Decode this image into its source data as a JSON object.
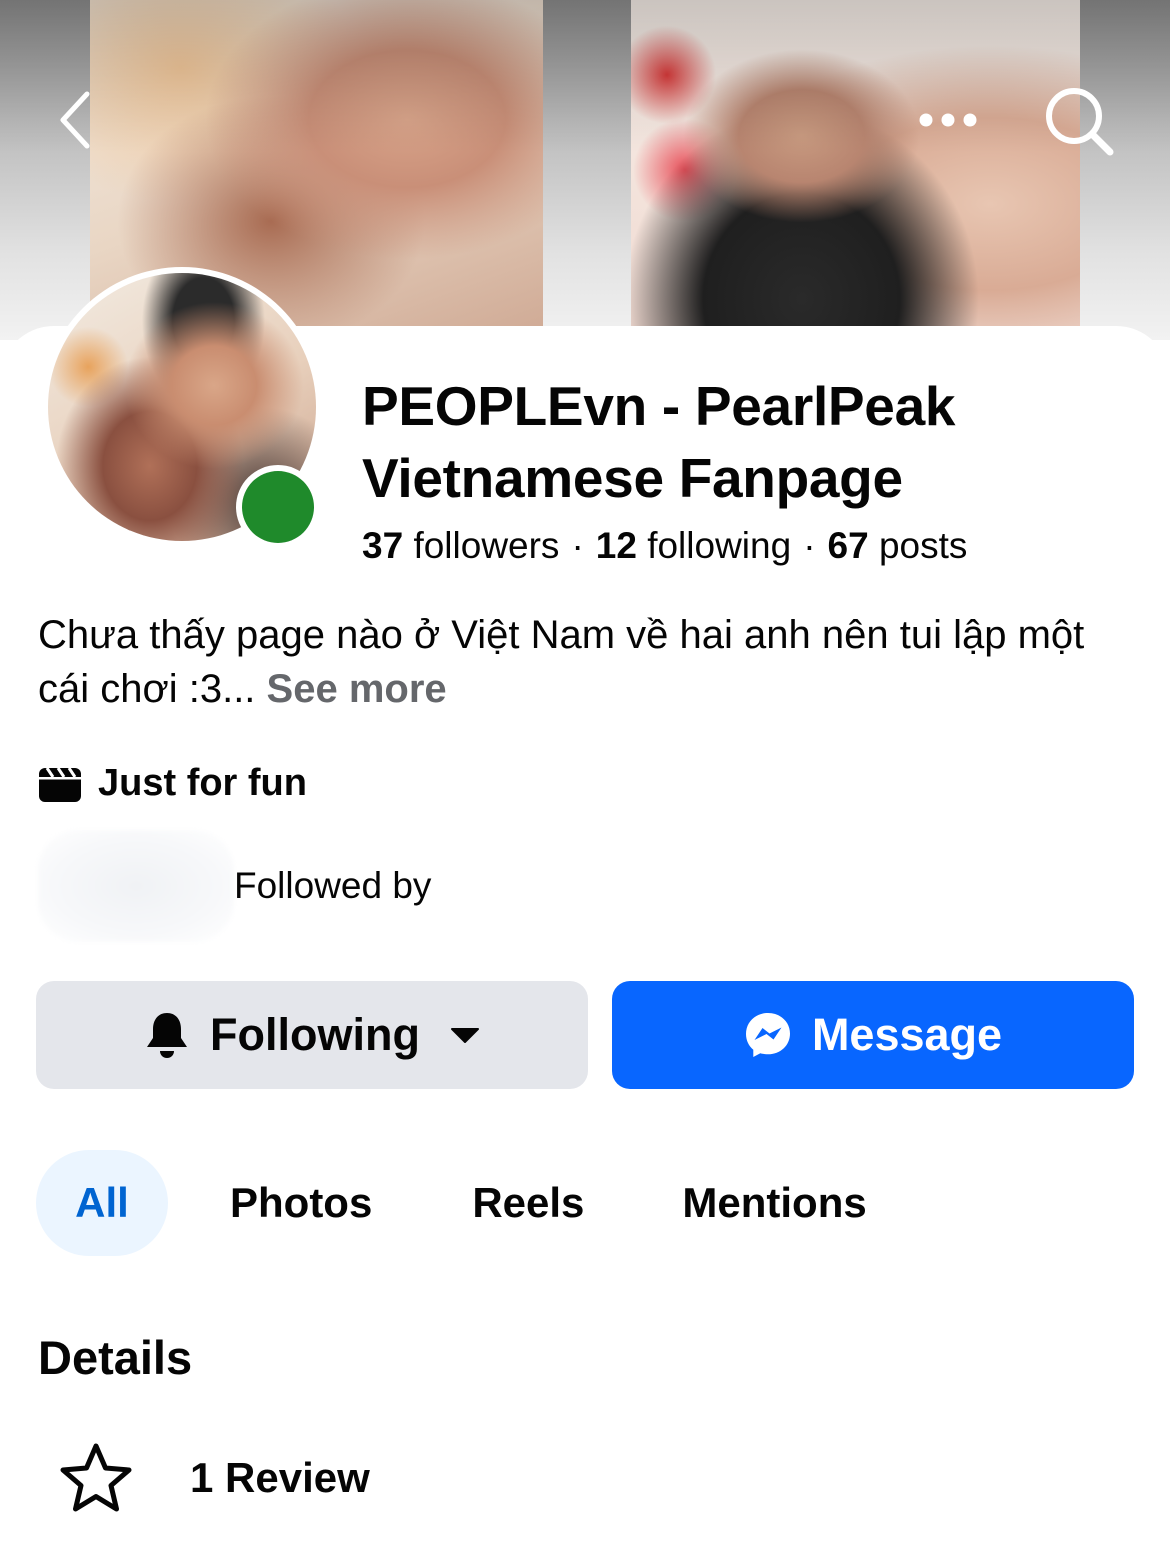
{
  "header": {
    "back_icon": "chevron-left-icon",
    "more_icon": "more-horizontal-icon",
    "search_icon": "search-icon"
  },
  "profile": {
    "name": "PEOPLEvn - PearlPeak Vietnamese Fanpage",
    "online_color": "#1f8a2b",
    "stats": {
      "followers_count": "37",
      "followers_label": "followers",
      "following_count": "12",
      "following_label": "following",
      "posts_count": "67",
      "posts_label": "posts",
      "separator": "·"
    },
    "bio": "Chưa thấy page nào ở Việt Nam về hai anh nên tui lập một cái chơi :3...",
    "see_more": "See more",
    "category": {
      "icon": "clapperboard-icon",
      "label": "Just for fun"
    },
    "followed_by": {
      "label": "Followed by"
    }
  },
  "actions": {
    "following": {
      "label": "Following",
      "icon": "bell-icon",
      "caret_icon": "caret-down-icon",
      "bg": "#e4e6eb"
    },
    "message": {
      "label": "Message",
      "icon": "messenger-icon",
      "bg": "#0866ff"
    }
  },
  "tabs": [
    {
      "label": "All",
      "active": true
    },
    {
      "label": "Photos",
      "active": false
    },
    {
      "label": "Reels",
      "active": false
    },
    {
      "label": "Mentions",
      "active": false
    }
  ],
  "details": {
    "title": "Details",
    "review": {
      "icon": "star-outline-icon",
      "label": "1 Review"
    }
  },
  "colors": {
    "accent": "#0866ff",
    "active_tab_text": "#0064d1",
    "active_tab_bg": "#ebf5ff",
    "secondary_text": "#65676b"
  }
}
